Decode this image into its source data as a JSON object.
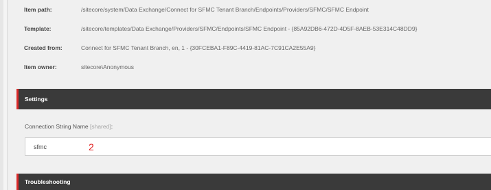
{
  "info": {
    "rows": [
      {
        "label": "Item path:",
        "value": "/sitecore/system/Data Exchange/Connect for SFMC Tenant Branch/Endpoints/Providers/SFMC/SFMC Endpoint"
      },
      {
        "label": "Template:",
        "value": "/sitecore/templates/Data Exchange/Providers/SFMC/Endpoints/SFMC Endpoint - {85A92DB6-472D-4D5F-8AEB-53E314C48DD9}"
      },
      {
        "label": "Created from:",
        "value": "Connect for SFMC Tenant Branch, en, 1 - {30FCEBA1-F89C-4419-81AC-7C91CA2E55A9}"
      },
      {
        "label": "Item owner:",
        "value": "sitecore\\Anonymous"
      }
    ]
  },
  "settings": {
    "title": "Settings",
    "field_label": "Connection String Name",
    "field_shared": "[shared]",
    "field_colon": ":",
    "field_value": "sfmc",
    "annotation": "2"
  },
  "troubleshooting": {
    "title": "Troubleshooting"
  },
  "colors": {
    "accent": "#dc2828",
    "header_bg": "#3a3a3a",
    "annotation": "#e02020"
  }
}
